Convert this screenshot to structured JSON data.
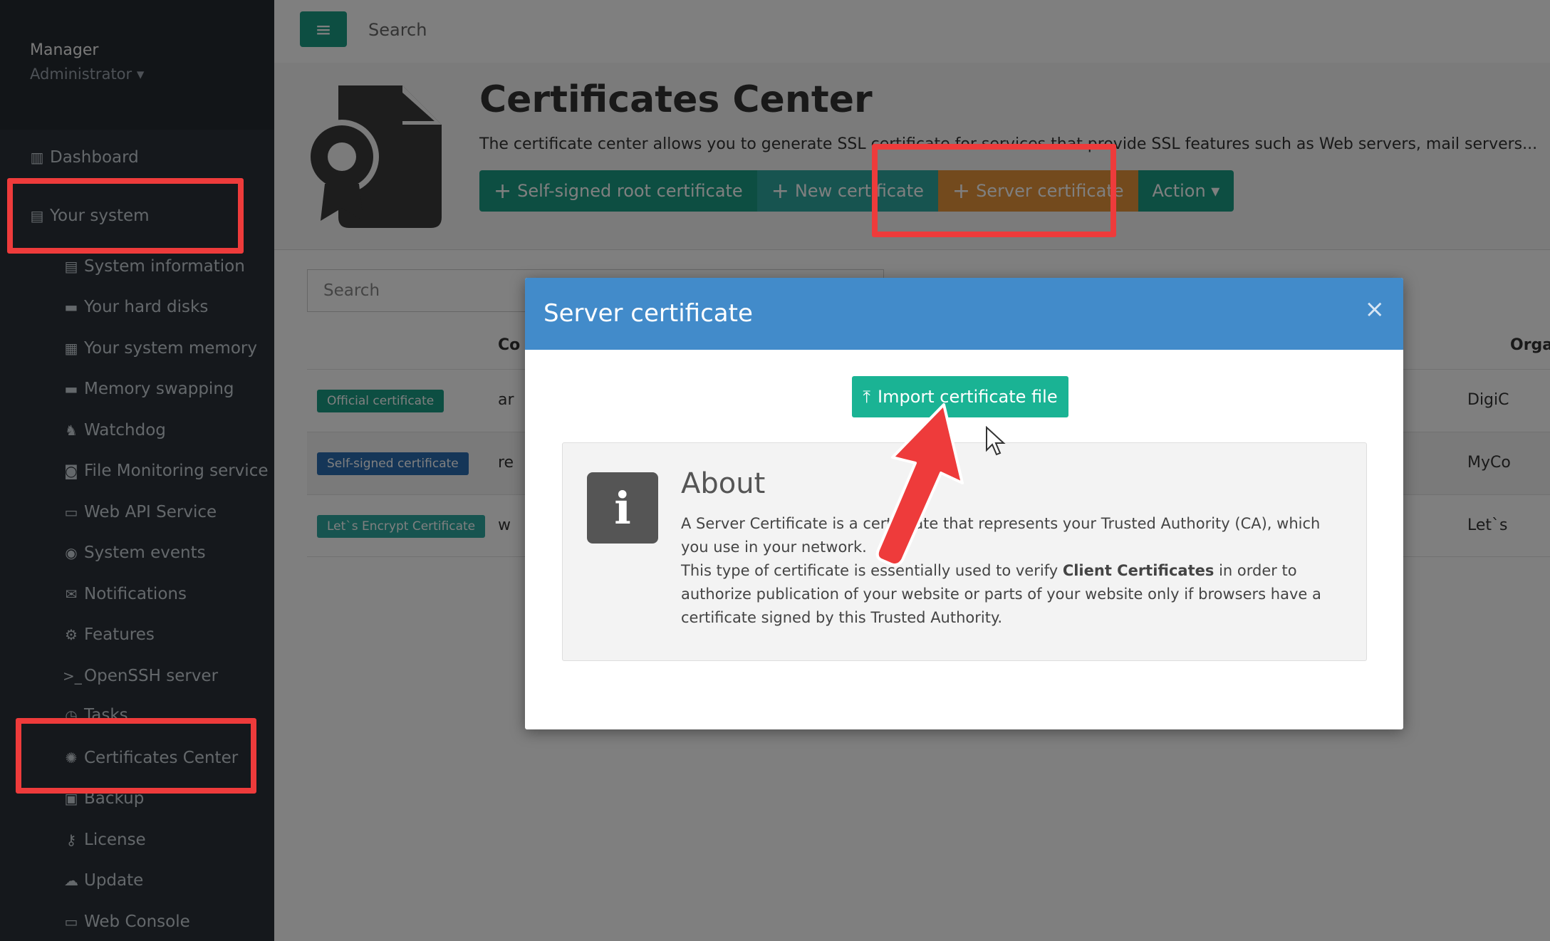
{
  "sidebar": {
    "user_name": "Manager",
    "user_role": "Administrator ▾",
    "items": [
      {
        "label": "Dashboard",
        "icon": "columns-icon"
      },
      {
        "label": "Your system",
        "icon": "server-icon"
      },
      {
        "label": "System information",
        "icon": "server-icon"
      },
      {
        "label": "Your hard disks",
        "icon": "hdd-icon"
      },
      {
        "label": "Your system memory",
        "icon": "memory-icon"
      },
      {
        "label": "Memory swapping",
        "icon": "hdd-icon"
      },
      {
        "label": "Watchdog",
        "icon": "dog-icon"
      },
      {
        "label": "File Monitoring service",
        "icon": "camera-icon"
      },
      {
        "label": "Web API Service",
        "icon": "window-icon"
      },
      {
        "label": "System events",
        "icon": "eye-icon"
      },
      {
        "label": "Notifications",
        "icon": "envelope-icon"
      },
      {
        "label": "Features",
        "icon": "gear-icon"
      },
      {
        "label": "OpenSSH server",
        "icon": "terminal-icon"
      },
      {
        "label": "Tasks",
        "icon": "clock-icon"
      },
      {
        "label": "Certificates Center",
        "icon": "certificate-icon"
      },
      {
        "label": "Backup",
        "icon": "archive-icon"
      },
      {
        "label": "License",
        "icon": "key-icon"
      },
      {
        "label": "Update",
        "icon": "cloud-download-icon"
      },
      {
        "label": "Web Console",
        "icon": "window-icon"
      }
    ]
  },
  "topbar": {
    "menu_icon": "≡",
    "search_label": "Search"
  },
  "header": {
    "title": "Certificates Center",
    "description": "The certificate center allows you to generate SSL certificate for services that provide SSL features such as Web servers, mail servers...",
    "buttons": {
      "self_signed": "Self-signed root certificate",
      "new_cert": "New certificate",
      "server_cert": "Server certificate",
      "action": "Action ▾"
    }
  },
  "list": {
    "search_placeholder": "Search",
    "col_cn": "Co",
    "col_org": "Orga",
    "rows": [
      {
        "tag": "Official certificate",
        "cn": "ar",
        "org": "DigiC"
      },
      {
        "tag": "Self-signed certificate",
        "cn": "re",
        "org": "MyCo"
      },
      {
        "tag": "Let`s Encrypt Certificate",
        "cn": "w",
        "org": "Let`s"
      }
    ]
  },
  "modal": {
    "title": "Server certificate",
    "close": "×",
    "import_button": "Import certificate file",
    "about_title": "About",
    "about_icon": "i",
    "about_p1": "A Server Certificate is a certificate that represents your Trusted Authority (CA), which you use in your network.",
    "about_p2_pre": "This type of certificate is essentially used to verify ",
    "about_p2_bold": "Client Certificates",
    "about_p2_post": " in order to authorize publication of your website or parts of your website only if browsers have a certificate signed by this Trusted Authority."
  },
  "colors": {
    "sidebar_bg": "#2a3038",
    "teal": "#1b9d84",
    "cyan": "#2fa9a1",
    "orange": "#e7943a",
    "modal_header": "#428bca",
    "highlight": "#ee3b3b"
  }
}
